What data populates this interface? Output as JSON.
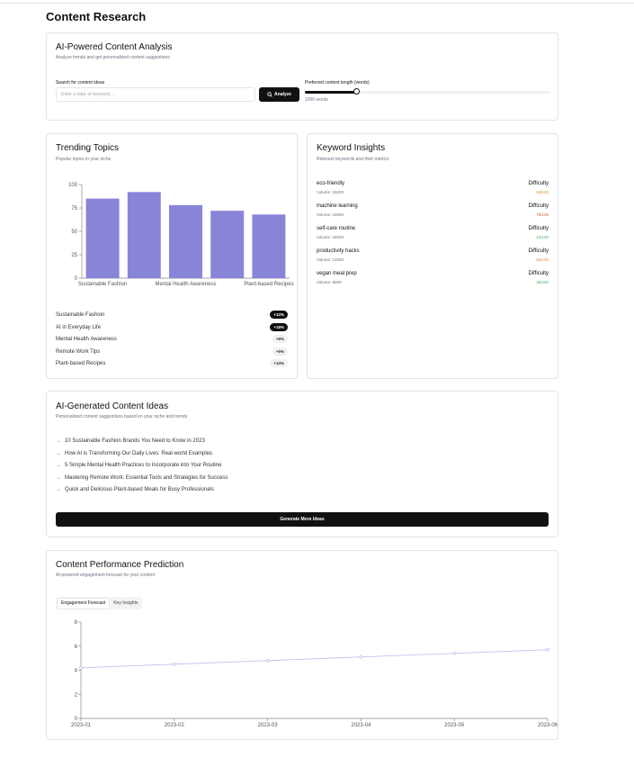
{
  "page": {
    "title": "Content Research"
  },
  "analysis": {
    "title": "AI-Powered Content Analysis",
    "subtitle": "Analyze trends and get personalized content suggestions",
    "search_label": "Search for content ideas",
    "search_placeholder": "Enter a topic or keyword...",
    "search_value": "",
    "analyze_label": "Analyze",
    "length_label": "Preferred content length (words)",
    "length_value_text": "1000 words",
    "length_fraction": 0.21
  },
  "trending": {
    "title": "Trending Topics",
    "subtitle": "Popular topics in your niche",
    "items": [
      {
        "name": "Sustainable Fashion",
        "change": "+12%",
        "highlight": true
      },
      {
        "name": "AI in Everyday Life",
        "change": "+18%",
        "highlight": true
      },
      {
        "name": "Mental Health Awareness",
        "change": "+8%",
        "highlight": false
      },
      {
        "name": "Remote Work Tips",
        "change": "+5%",
        "highlight": false
      },
      {
        "name": "Plant-based Recipes",
        "change": "+10%",
        "highlight": false
      }
    ]
  },
  "keywords": {
    "title": "Keyword Insights",
    "subtitle": "Relevant keywords and their metrics",
    "difficulty_label": "Difficulty",
    "items": [
      {
        "keyword": "eco-friendly",
        "volume": "Volume: 15000",
        "difficulty": "65/100",
        "color": "#d9903d"
      },
      {
        "keyword": "machine learning",
        "volume": "Volume: 22000",
        "difficulty": "78/100",
        "color": "#d45a4a"
      },
      {
        "keyword": "self-care routine",
        "volume": "Volume: 18000",
        "difficulty": "42/100",
        "color": "#4caf63"
      },
      {
        "keyword": "productivity hacks",
        "volume": "Volume: 12000",
        "difficulty": "55/100",
        "color": "#d9903d"
      },
      {
        "keyword": "vegan meal prep",
        "volume": "Volume: 9000",
        "difficulty": "38/100",
        "color": "#4caf63"
      }
    ]
  },
  "ideas": {
    "title": "AI-Generated Content Ideas",
    "subtitle": "Personalized content suggestions based on your niche and trends",
    "arrow": "→",
    "items": [
      "10 Sustainable Fashion Brands You Need to Know in 2023",
      "How AI is Transforming Our Daily Lives: Real-world Examples",
      "5 Simple Mental Health Practices to Incorporate into Your Routine",
      "Mastering Remote Work: Essential Tools and Strategies for Success",
      "Quick and Delicious Plant-based Meals for Busy Professionals"
    ],
    "button_label": "Generate More Ideas"
  },
  "performance": {
    "title": "Content Performance Prediction",
    "subtitle": "AI-powered engagement forecast for your content",
    "tabs": [
      {
        "label": "Engagement Forecast",
        "active": true
      },
      {
        "label": "Key Insights",
        "active": false
      }
    ]
  },
  "chart_data": [
    {
      "type": "bar",
      "categories": [
        "Sustainable Fashion",
        "AI in Everyday Life",
        "Mental Health Awareness",
        "Remote Work Tips",
        "Plant-based Recipes"
      ],
      "tick_labels": [
        "Sustainable Fashion",
        "Mental Health Awareness",
        "Plant-based Recipes"
      ],
      "values": [
        85,
        92,
        78,
        72,
        68
      ],
      "yticks": [
        0,
        25,
        50,
        75,
        100
      ],
      "ylim": [
        0,
        100
      ],
      "color": "#8884d8",
      "grid": false,
      "legend": "none"
    },
    {
      "type": "line",
      "x": [
        "2023-01",
        "2023-02",
        "2023-03",
        "2023-04",
        "2023-05",
        "2023-06"
      ],
      "values": [
        4.2,
        4.5,
        4.8,
        5.1,
        5.4,
        5.7
      ],
      "yticks": [
        0,
        2,
        4,
        6,
        8
      ],
      "ylim": [
        0,
        8
      ],
      "color": "#8884d8",
      "grid": false,
      "legend": "none"
    }
  ]
}
